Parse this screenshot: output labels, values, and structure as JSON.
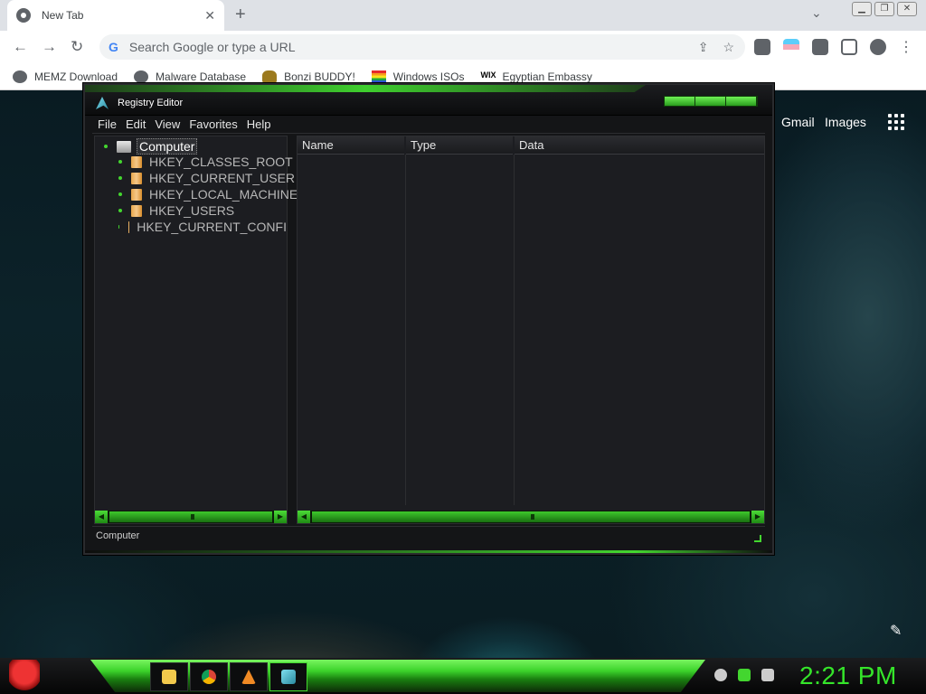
{
  "browser": {
    "tab_title": "New Tab",
    "omnibox_placeholder": "Search Google or type a URL",
    "bookmarks": [
      "MEMZ Download",
      "Malware Database",
      "Bonzi BUDDY!",
      "Windows ISOs",
      "Egyptian Embassy"
    ],
    "google_links": {
      "gmail": "Gmail",
      "images": "Images"
    }
  },
  "regedit": {
    "title": "Registry Editor",
    "menu": [
      "File",
      "Edit",
      "View",
      "Favorites",
      "Help"
    ],
    "tree_root": "Computer",
    "tree_items": [
      "HKEY_CLASSES_ROOT",
      "HKEY_CURRENT_USER",
      "HKEY_LOCAL_MACHINE",
      "HKEY_USERS",
      "HKEY_CURRENT_CONFI"
    ],
    "columns": [
      "Name",
      "Type",
      "Data"
    ],
    "status": "Computer"
  },
  "taskbar": {
    "clock": "2:21 PM",
    "icons": [
      "explorer-icon",
      "chrome-icon",
      "vlc-icon",
      "regedit-icon"
    ]
  },
  "colors": {
    "accent_green": "#43d62f",
    "window_bg": "#141517",
    "pane_bg": "#1c1d21"
  }
}
